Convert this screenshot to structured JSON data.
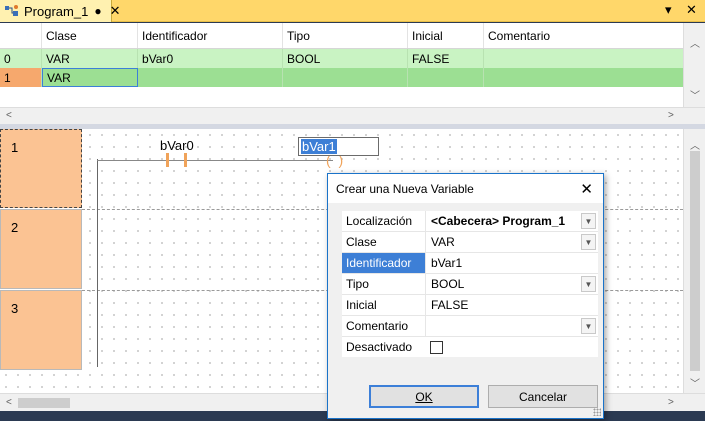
{
  "tab": {
    "title": "Program_1",
    "modified_marker": "●",
    "close_glyph": "✕",
    "icon": "ladder-program-icon"
  },
  "window_controls": {
    "menu_glyph": "▾",
    "close_glyph": "✕"
  },
  "var_table": {
    "headers": [
      "Clase",
      "Identificador",
      "Tipo",
      "Inicial",
      "Comentario"
    ],
    "rows": [
      {
        "index": "0",
        "clase": "VAR",
        "identificador": "bVar0",
        "tipo": "BOOL",
        "inicial": "FALSE",
        "comentario": ""
      },
      {
        "index": "1",
        "clase": "VAR",
        "identificador": "",
        "tipo": "",
        "inicial": "",
        "comentario": ""
      }
    ]
  },
  "ladder": {
    "rungs": [
      "1",
      "2",
      "3"
    ],
    "contact_var": "bVar0",
    "coil_edit_value": "bVar1"
  },
  "dialog": {
    "title": "Crear una Nueva Variable",
    "fields": {
      "localizacion": {
        "label": "Localización",
        "value_tag": "<Cabecera>",
        "value_name": "Program_1"
      },
      "clase": {
        "label": "Clase",
        "value": "VAR"
      },
      "identificador": {
        "label": "Identificador",
        "value": "bVar1"
      },
      "tipo": {
        "label": "Tipo",
        "value": "BOOL"
      },
      "inicial": {
        "label": "Inicial",
        "value": "FALSE"
      },
      "comentario": {
        "label": "Comentario",
        "value": ""
      },
      "desactivado": {
        "label": "Desactivado",
        "checked": false
      }
    },
    "ok_label": "OK",
    "cancel_label": "Cancelar"
  },
  "colors": {
    "row_green": "#c9f3c3",
    "row_selected_green": "#9cdf93",
    "rung_orange": "#fbc393",
    "selection_blue": "#3d7fd6",
    "tab_yellow": "#ffd76a"
  }
}
